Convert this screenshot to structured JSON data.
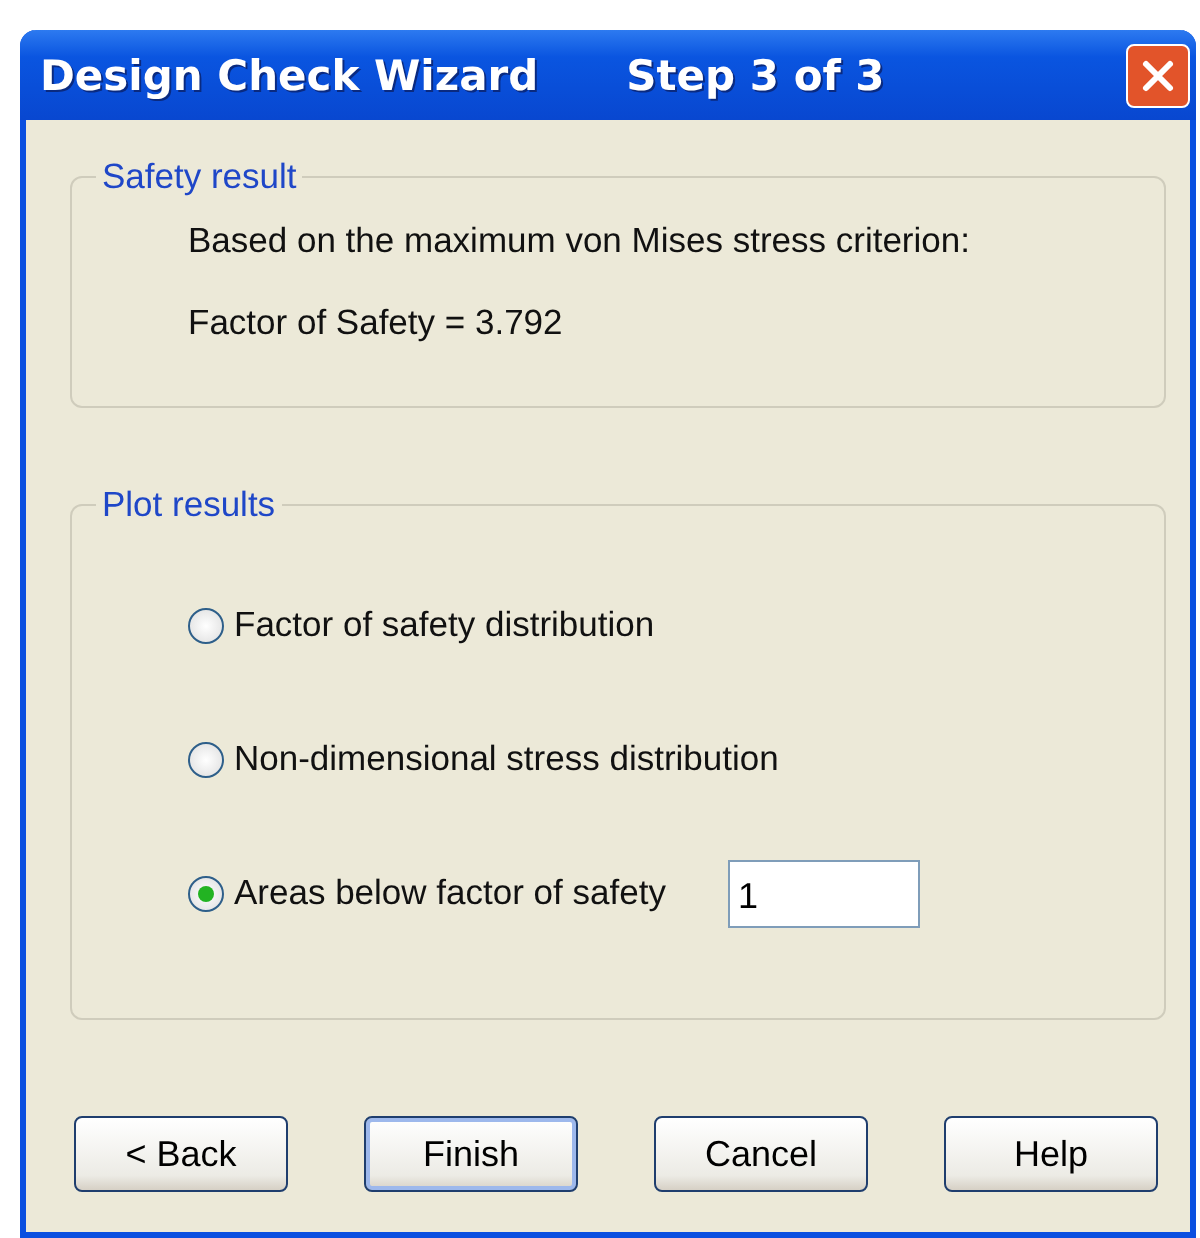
{
  "window": {
    "title": "Design Check Wizard",
    "step": "Step 3 of 3"
  },
  "safety_result": {
    "legend": "Safety result",
    "lines": [
      "Based on the maximum von Mises stress criterion:",
      "Factor of Safety = 3.792"
    ]
  },
  "plot_results": {
    "legend": "Plot results",
    "options": [
      {
        "label": "Factor of safety distribution",
        "selected": false
      },
      {
        "label": "Non-dimensional stress distribution",
        "selected": false
      },
      {
        "label": "Areas below factor of safety",
        "selected": true,
        "value": "1"
      }
    ]
  },
  "buttons": [
    {
      "label": "< Back",
      "default": false
    },
    {
      "label": "Finish",
      "default": true
    },
    {
      "label": "Cancel",
      "default": false
    },
    {
      "label": "Help",
      "default": false
    }
  ]
}
